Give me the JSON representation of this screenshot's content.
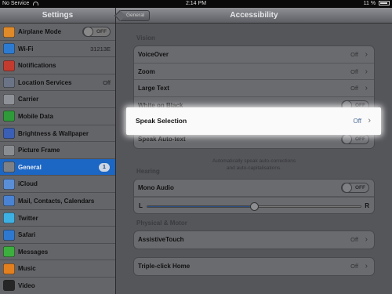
{
  "status_bar": {
    "carrier": "No Service",
    "time": "2:14 PM",
    "battery": "11 %"
  },
  "master": {
    "title": "Settings",
    "items": [
      {
        "label": "Airplane Mode",
        "icon": "airplane-icon",
        "color": "#e08a2a",
        "toggle": "OFF"
      },
      {
        "label": "Wi-Fi",
        "icon": "wifi-icon",
        "color": "#2d7bd1",
        "value": "31213E"
      },
      {
        "label": "Notifications",
        "icon": "notifications-icon",
        "color": "#c33b2e"
      },
      {
        "label": "Location Services",
        "icon": "location-icon",
        "color": "#6b7486",
        "value": "Off"
      },
      {
        "label": "Carrier",
        "icon": "carrier-icon",
        "color": "#8e9197"
      },
      {
        "label": "Mobile Data",
        "icon": "mobile-data-icon",
        "color": "#2f9a39"
      },
      {
        "label": "Brightness & Wallpaper",
        "icon": "brightness-icon",
        "color": "#3a5fb5"
      },
      {
        "label": "Picture Frame",
        "icon": "picture-frame-icon",
        "color": "#8a8d92"
      },
      {
        "label": "General",
        "icon": "gear-icon",
        "color": "#7d8085",
        "badge": "1",
        "selected": true
      },
      {
        "label": "iCloud",
        "icon": "icloud-icon",
        "color": "#5a8fd8"
      },
      {
        "label": "Mail, Contacts, Calendars",
        "icon": "mail-icon",
        "color": "#4a83d3"
      },
      {
        "label": "Twitter",
        "icon": "twitter-icon",
        "color": "#3db1e4"
      },
      {
        "label": "Safari",
        "icon": "safari-icon",
        "color": "#2f78d0"
      },
      {
        "label": "Messages",
        "icon": "messages-icon",
        "color": "#3caf3f"
      },
      {
        "label": "Music",
        "icon": "music-icon",
        "color": "#e27f1f"
      },
      {
        "label": "Video",
        "icon": "video-icon",
        "color": "#262626"
      }
    ]
  },
  "detail": {
    "back_label": "General",
    "title": "Accessibility",
    "vision": {
      "header": "Vision",
      "rows": [
        {
          "label": "VoiceOver",
          "value": "Off"
        },
        {
          "label": "Zoom",
          "value": "Off"
        },
        {
          "label": "Large Text",
          "value": "Off"
        },
        {
          "label": "White on Black",
          "toggle": "OFF"
        },
        {
          "label": "Speak Selection",
          "value": "Off"
        },
        {
          "label": "Speak Auto-text",
          "toggle": "OFF"
        }
      ],
      "footnote_1": "Automatically speak auto-corrections",
      "footnote_2": "and auto-capitalisations."
    },
    "hearing": {
      "header": "Hearing",
      "mono_label": "Mono Audio",
      "mono_toggle": "OFF",
      "left_label": "L",
      "right_label": "R",
      "balance": 0.5
    },
    "motor": {
      "header": "Physical & Motor",
      "assistive_label": "AssistiveTouch",
      "assistive_value": "Off",
      "triple_label": "Triple-click Home",
      "triple_value": "Off"
    }
  },
  "accent_color": "#1c66c4"
}
